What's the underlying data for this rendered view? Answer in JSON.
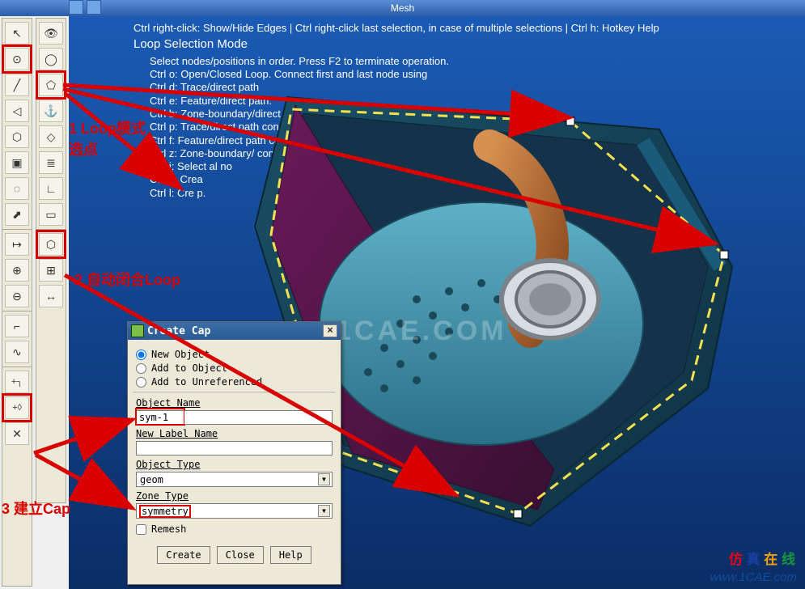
{
  "window": {
    "title": "Mesh"
  },
  "help": {
    "top": "Ctrl right-click: Show/Hide Edges | Ctrl right-click last selection, in case of multiple selections | Ctrl h: Hotkey Help",
    "mode": "Loop Selection Mode",
    "sub": "Select nodes/positions in order. Press F2 to terminate operation.",
    "o": "Ctrl o: Open/Closed Loop. Connect first and last node using",
    "d": "Ctrl d: Trace/direct path",
    "e": "Ctrl e: Feature/direct path.",
    "b": "Ctrl b: Zone-boundary/direct path.",
    "p": "Ctrl p: Trace/direct path connecting",
    "f": "Ctrl f: Feature/direct path con                   st and second last no",
    "z": "Ctrl z: Zone-boundary/               connecting last and second last no",
    "j": "Ctrl j: Select al  no",
    "k": "Ctrl k: Crea",
    "l": "Ctrl l: Cre                 p."
  },
  "annotations": {
    "a1": "1 Loop模式选点",
    "a2": "2 自动闭合Loop",
    "a3": "3 建立Cap"
  },
  "dialog": {
    "title": "Create Cap",
    "opt_new": "New Object",
    "opt_add": "Add to Object",
    "opt_unref": "Add to Unreferenced",
    "object_name_label": "Object Name",
    "object_name_value": "sym-1",
    "new_label_label": "New Label Name",
    "new_label_value": "",
    "object_type_label": "Object Type",
    "object_type_value": "geom",
    "zone_type_label": "Zone Type",
    "zone_type_value": "symmetry",
    "remesh": "Remesh",
    "btn_create": "Create",
    "btn_close": "Close",
    "btn_help": "Help"
  },
  "watermark": "1CAE.COM",
  "brand_cn": "仿真在线",
  "brand_url": "www.1CAE.com"
}
